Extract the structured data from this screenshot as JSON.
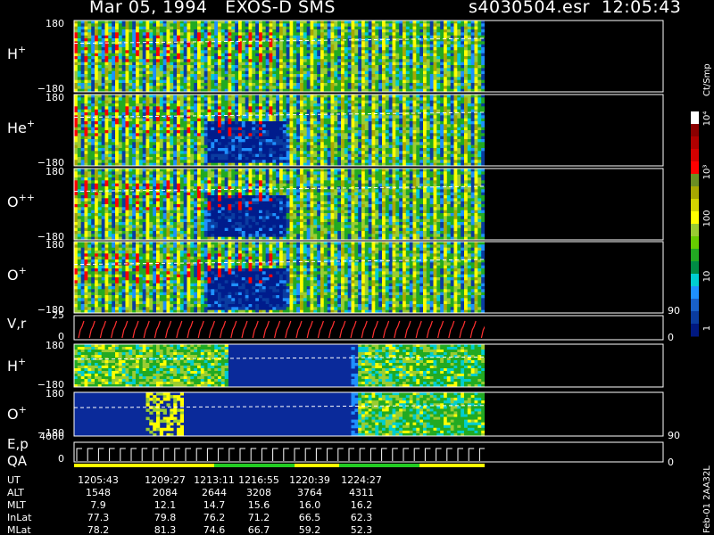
{
  "header": {
    "title": "Mar 05, 1994   EXOS-D SMS",
    "file": "s4030504.esr  12:05:43"
  },
  "panels": [
    {
      "id": "H+ pitch",
      "label": "H",
      "sup": "+",
      "top_tick": "180",
      "bottom_tick": "−180"
    },
    {
      "id": "He+ pitch",
      "label": "He",
      "sup": "+",
      "top_tick": "180",
      "bottom_tick": "−180"
    },
    {
      "id": "O++ pitch",
      "label": "O",
      "sup": "++",
      "top_tick": "180",
      "bottom_tick": "−180"
    },
    {
      "id": "O+ pitch",
      "label": "O",
      "sup": "+",
      "top_tick": "180",
      "bottom_tick": "−180"
    }
  ],
  "vr_panel": {
    "label": "V,r",
    "top_tick": "25",
    "bottom_tick": "0",
    "right_top": "90",
    "right_bottom": "0"
  },
  "lower_panels": [
    {
      "id": "H+ low",
      "label": "H",
      "sup": "+",
      "top_tick": "180",
      "bottom_tick": "−180"
    },
    {
      "id": "O+ low",
      "label": "O",
      "sup": "+",
      "top_tick": "180",
      "bottom_tick": "−180"
    }
  ],
  "ep_panel": {
    "label1": "E,p",
    "label2": "QA",
    "top_tick": "4000",
    "bottom_tick": "0",
    "right_top": "90",
    "right_bottom": "0"
  },
  "colorbar": {
    "unit": "Ct/Smp",
    "ticks": [
      "10⁴",
      "10³",
      "100",
      "10",
      "1"
    ],
    "colors": [
      "#ffffff",
      "#8b0000",
      "#b00000",
      "#d40000",
      "#ff0000",
      "#6b8e23",
      "#a8a800",
      "#d4d400",
      "#ffff00",
      "#9acd32",
      "#66cc00",
      "#22aa22",
      "#008b45",
      "#00ced1",
      "#1e90ff",
      "#1860c8",
      "#0a3ca0",
      "#001880"
    ]
  },
  "chart_data": {
    "type": "heatmap",
    "title": "Mar 05, 1994   EXOS-D SMS",
    "x_axis": {
      "rows": [
        {
          "name": "UT",
          "values": [
            "1205:43",
            "1209:27",
            "1213:11",
            "1216:55",
            "1220:39",
            "1224:27"
          ]
        },
        {
          "name": "ALT",
          "values": [
            "1548",
            "2084",
            "2644",
            "3208",
            "3764",
            "4311"
          ]
        },
        {
          "name": "MLT",
          "values": [
            "7.9",
            "12.1",
            "14.7",
            "15.6",
            "16.0",
            "16.2"
          ]
        },
        {
          "name": "InLat",
          "values": [
            "77.3",
            "79.8",
            "76.2",
            "71.2",
            "66.5",
            "62.3"
          ]
        },
        {
          "name": "MLat",
          "values": [
            "78.2",
            "81.3",
            "74.6",
            "66.7",
            "59.2",
            "52.3"
          ]
        }
      ]
    },
    "y_range_pitch": [
      -180,
      180
    ],
    "y_range_vr": [
      0,
      25
    ],
    "y_range_ep": [
      0,
      4000
    ],
    "colorbar_range": [
      1,
      10000
    ],
    "colorbar_scale": "log"
  },
  "side_text": "Feb-01 2AA32L"
}
